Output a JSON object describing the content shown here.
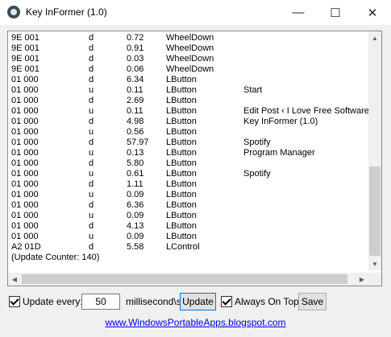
{
  "window": {
    "title": "Key InFormer (1.0)",
    "minimize": "—",
    "maximize": "☐",
    "close": "✕"
  },
  "log": {
    "rows": [
      {
        "code": "9E  001",
        "dir": "d",
        "time": "0.72",
        "key": "WheelDown",
        "window": ""
      },
      {
        "code": "9E  001",
        "dir": "d",
        "time": "0.91",
        "key": "WheelDown",
        "window": ""
      },
      {
        "code": "9E  001",
        "dir": "d",
        "time": "0.03",
        "key": "WheelDown",
        "window": ""
      },
      {
        "code": "9E  001",
        "dir": "d",
        "time": "0.06",
        "key": "WheelDown",
        "window": ""
      },
      {
        "code": "01  000",
        "dir": "d",
        "time": "6.34",
        "key": "LButton",
        "window": ""
      },
      {
        "code": "01  000",
        "dir": "u",
        "time": "0.11",
        "key": "LButton",
        "window": "Start"
      },
      {
        "code": "01  000",
        "dir": "d",
        "time": "2.69",
        "key": "LButton",
        "window": ""
      },
      {
        "code": "01  000",
        "dir": "u",
        "time": "0.11",
        "key": "LButton",
        "window": "Edit Post ‹ I Love Free Software"
      },
      {
        "code": "01  000",
        "dir": "d",
        "time": "4.98",
        "key": "LButton",
        "window": "Key InFormer (1.0)"
      },
      {
        "code": "01  000",
        "dir": "u",
        "time": "0.56",
        "key": "LButton",
        "window": ""
      },
      {
        "code": "01  000",
        "dir": "d",
        "time": "57.97",
        "key": "LButton",
        "window": "Spotify"
      },
      {
        "code": "01  000",
        "dir": "u",
        "time": "0.13",
        "key": "LButton",
        "window": "Program Manager"
      },
      {
        "code": "01  000",
        "dir": "d",
        "time": "5.80",
        "key": "LButton",
        "window": ""
      },
      {
        "code": "01  000",
        "dir": "u",
        "time": "0.61",
        "key": "LButton",
        "window": "Spotify"
      },
      {
        "code": "01  000",
        "dir": "d",
        "time": "1.11",
        "key": "LButton",
        "window": ""
      },
      {
        "code": "01  000",
        "dir": "u",
        "time": "0.09",
        "key": "LButton",
        "window": ""
      },
      {
        "code": "01  000",
        "dir": "d",
        "time": "6.36",
        "key": "LButton",
        "window": ""
      },
      {
        "code": "01  000",
        "dir": "u",
        "time": "0.09",
        "key": "LButton",
        "window": ""
      },
      {
        "code": "01  000",
        "dir": "d",
        "time": "4.13",
        "key": "LButton",
        "window": ""
      },
      {
        "code": "01  000",
        "dir": "u",
        "time": "0.09",
        "key": "LButton",
        "window": ""
      },
      {
        "code": "A2  01D",
        "dir": "d",
        "time": "5.58",
        "key": "LControl",
        "window": ""
      }
    ],
    "counter": "(Update Counter: 140)"
  },
  "controls": {
    "update_every_label": "Update every:",
    "interval_value": "50",
    "unit_label": "millisecond\\s",
    "update_button": "Update",
    "always_on_top_label": "Always On Top",
    "save_button": "Save"
  },
  "footer": {
    "link": "www.WindowsPortableApps.blogspot.com"
  }
}
